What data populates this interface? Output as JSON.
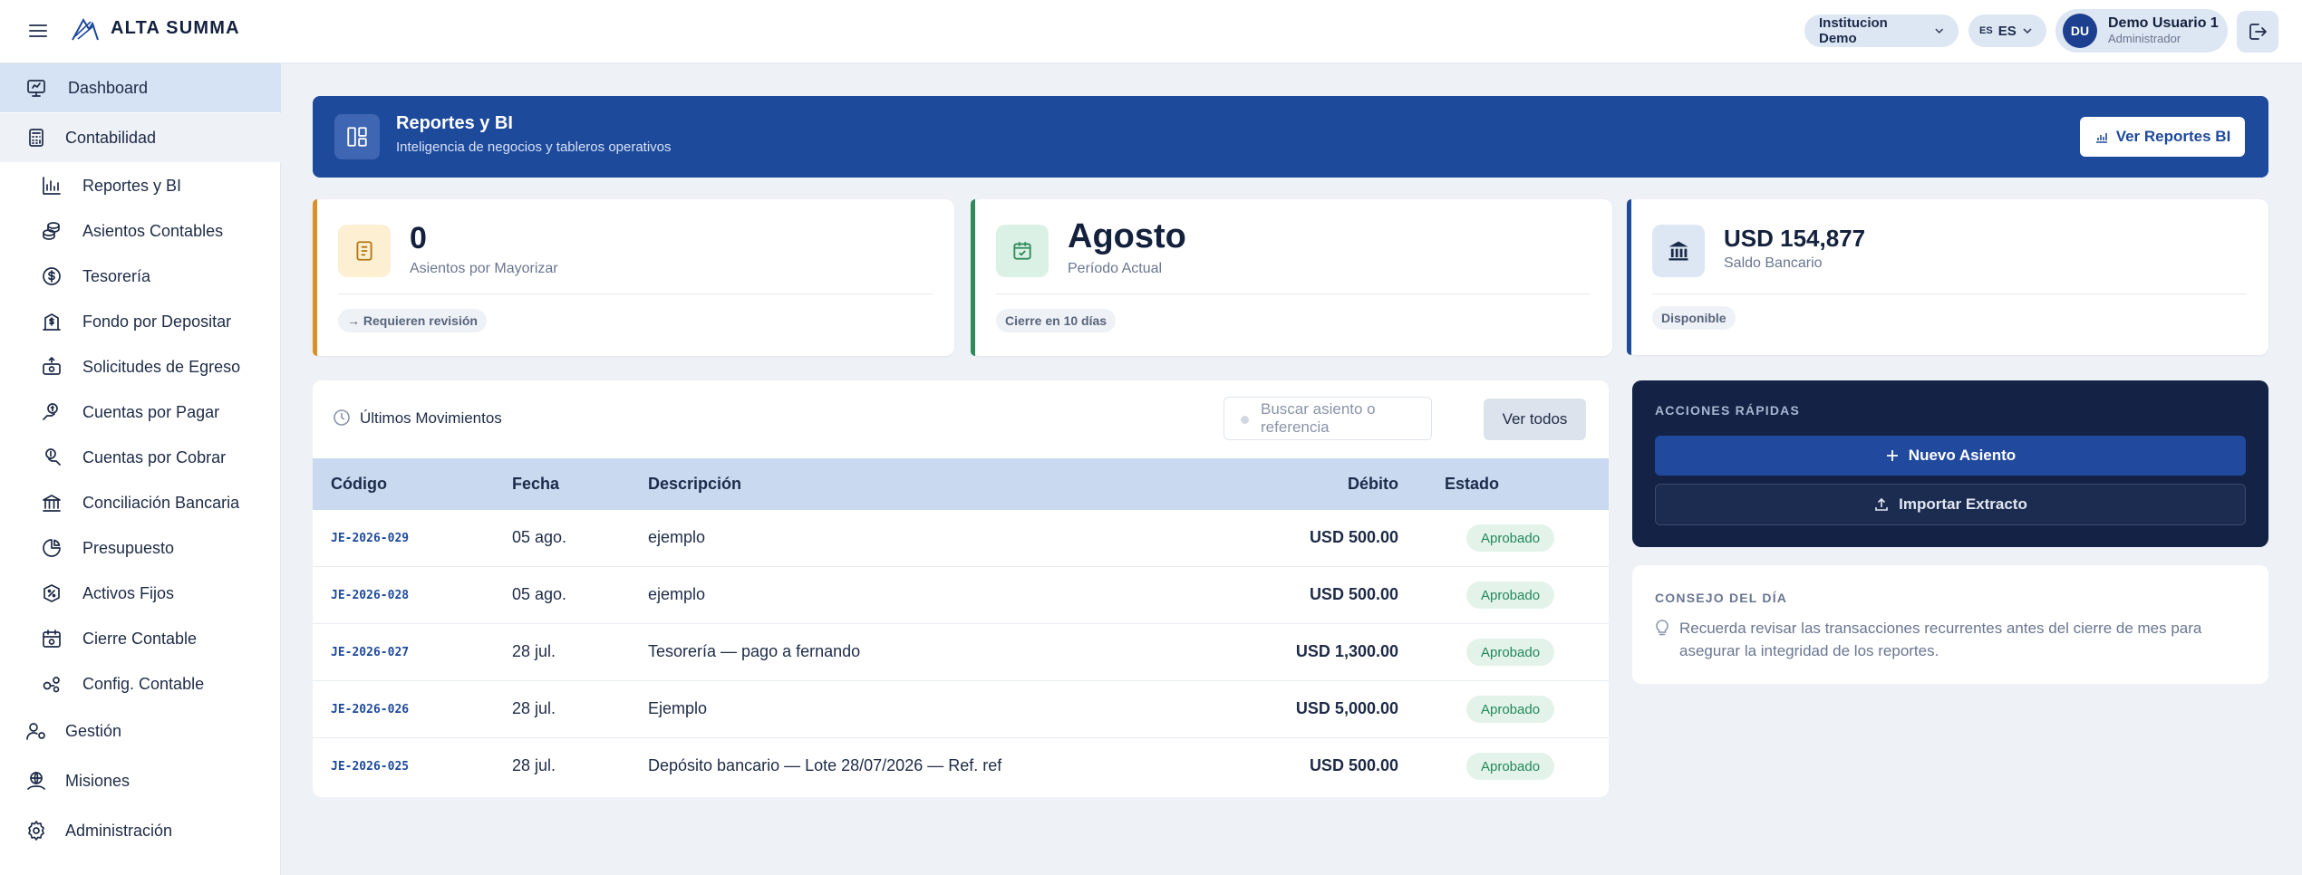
{
  "header": {
    "brand": "ALTA SUMMA",
    "institution": "Institucion Demo",
    "language_code": "ES",
    "language_label": "ES",
    "user_initials": "DU",
    "user_name": "Demo Usuario 1",
    "user_role": "Administrador"
  },
  "sidebar": {
    "items": [
      {
        "label": "Dashboard",
        "icon": "monitor-icon"
      },
      {
        "label": "Contabilidad",
        "icon": "calculator-icon"
      },
      {
        "label": "Gestión",
        "icon": "users-gear-icon"
      },
      {
        "label": "Misiones",
        "icon": "globe-icon"
      },
      {
        "label": "Administración",
        "icon": "gear-icon"
      }
    ],
    "subitems": [
      {
        "label": "Reportes y BI",
        "icon": "bar-chart-icon"
      },
      {
        "label": "Asientos Contables",
        "icon": "coins-icon"
      },
      {
        "label": "Tesorería",
        "icon": "dollar-circle-icon"
      },
      {
        "label": "Fondo por Depositar",
        "icon": "building-dollar-icon"
      },
      {
        "label": "Solicitudes de Egreso",
        "icon": "money-out-icon"
      },
      {
        "label": "Cuentas por Pagar",
        "icon": "hand-coin-icon"
      },
      {
        "label": "Cuentas por Cobrar",
        "icon": "hand-receive-icon"
      },
      {
        "label": "Conciliación Bancaria",
        "icon": "bank-icon"
      },
      {
        "label": "Presupuesto",
        "icon": "pie-icon"
      },
      {
        "label": "Activos Fijos",
        "icon": "tag-percent-icon"
      },
      {
        "label": "Cierre Contable",
        "icon": "calendar-lock-icon"
      },
      {
        "label": "Config. Contable",
        "icon": "config-gears-icon"
      }
    ]
  },
  "banner": {
    "title": "Reportes y BI",
    "subtitle": "Inteligencia de negocios y tableros operativos",
    "button": "Ver Reportes BI"
  },
  "cards": [
    {
      "value": "0",
      "label": "Asientos por Mayorizar",
      "badge": "→ Requieren revisión",
      "accent": "#d9902a"
    },
    {
      "value": "Agosto",
      "label": "Período Actual",
      "badge": "Cierre en 10 días",
      "accent": "#2f8a5c"
    },
    {
      "value": "USD 154,877",
      "label": "Saldo Bancario",
      "badge": "Disponible",
      "accent": "#1e4a9c"
    }
  ],
  "movements": {
    "title": "Últimos Movimientos",
    "search_placeholder": "Buscar asiento o referencia",
    "view_all": "Ver todos",
    "columns": [
      "Código",
      "Fecha",
      "Descripción",
      "Débito",
      "Estado"
    ],
    "rows": [
      {
        "code": "JE-2026-029",
        "date": "05 ago.",
        "desc": "ejemplo",
        "debit": "USD 500.00",
        "status": "Aprobado"
      },
      {
        "code": "JE-2026-028",
        "date": "05 ago.",
        "desc": "ejemplo",
        "debit": "USD 500.00",
        "status": "Aprobado"
      },
      {
        "code": "JE-2026-027",
        "date": "28 jul.",
        "desc": "Tesorería — pago a fernando",
        "debit": "USD 1,300.00",
        "status": "Aprobado"
      },
      {
        "code": "JE-2026-026",
        "date": "28 jul.",
        "desc": "Ejemplo",
        "debit": "USD 5,000.00",
        "status": "Aprobado"
      },
      {
        "code": "JE-2026-025",
        "date": "28 jul.",
        "desc": "Depósito bancario — Lote 28/07/2026 — Ref. ref",
        "debit": "USD 500.00",
        "status": "Aprobado"
      }
    ]
  },
  "quick_actions": {
    "title": "ACCIONES RÁPIDAS",
    "primary": "Nuevo Asiento",
    "secondary": "Importar Extracto"
  },
  "tip": {
    "title": "CONSEJO DEL DÍA",
    "text": "Recuerda revisar las transacciones recurrentes antes del cierre de mes para asegurar la integridad de los reportes."
  }
}
